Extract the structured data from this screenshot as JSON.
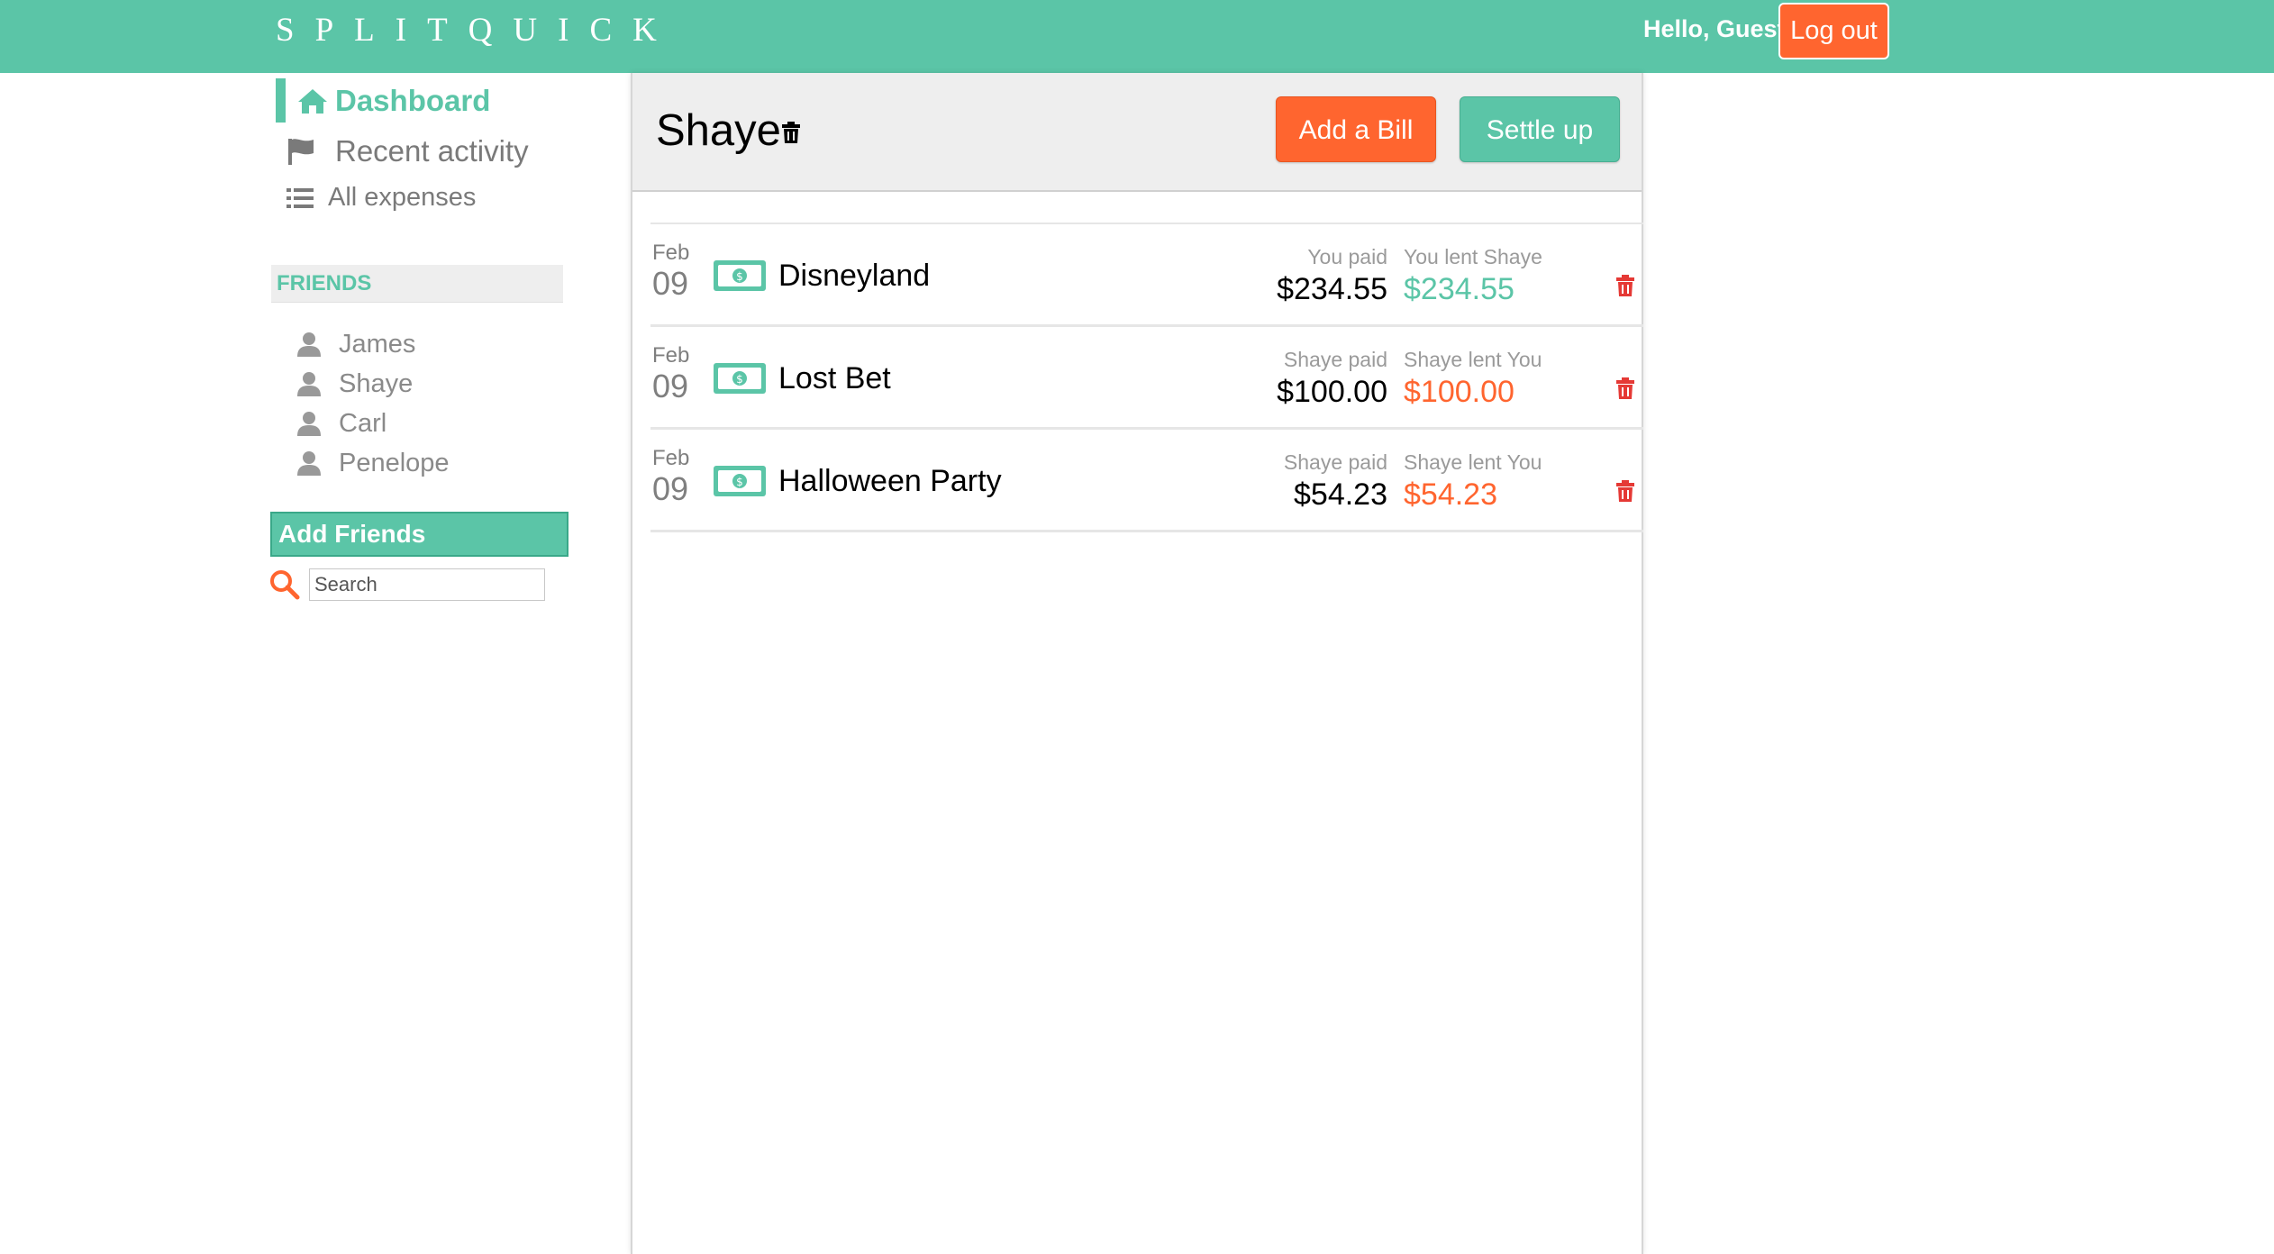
{
  "header": {
    "brand": "SPLITQUICK",
    "greeting": "Hello, Guest",
    "logout_label": "Log out",
    "bg_color": "#5bc5a7"
  },
  "sidebar": {
    "nav": [
      {
        "label": "Dashboard",
        "icon": "home-icon",
        "active": true
      },
      {
        "label": "Recent activity",
        "icon": "flag-icon"
      },
      {
        "label": "All expenses",
        "icon": "list-icon"
      }
    ],
    "friends_heading": "FRIENDS",
    "friends": [
      "James",
      "Shaye",
      "Carl",
      "Penelope"
    ],
    "add_friends_label": "Add Friends",
    "search": {
      "placeholder": "Search",
      "value": ""
    }
  },
  "main": {
    "title": "Shaye",
    "add_bill_label": "Add a Bill",
    "settle_up_label": "Settle up",
    "expenses": [
      {
        "month": "Feb",
        "day": "09",
        "title": "Disneyland",
        "paid_label": "You paid",
        "paid_amount": "$234.55",
        "lent_label": "You lent Shaye",
        "lent_amount": "$234.55",
        "lent_color": "green"
      },
      {
        "month": "Feb",
        "day": "09",
        "title": "Lost Bet",
        "paid_label": "Shaye paid",
        "paid_amount": "$100.00",
        "lent_label": "Shaye lent You",
        "lent_amount": "$100.00",
        "lent_color": "orange"
      },
      {
        "month": "Feb",
        "day": "09",
        "title": "Halloween Party",
        "paid_label": "Shaye paid",
        "paid_amount": "$54.23",
        "lent_label": "Shaye lent You",
        "lent_amount": "$54.23",
        "lent_color": "orange"
      }
    ]
  },
  "colors": {
    "accent_green": "#5bc5a7",
    "accent_orange": "#ff652f",
    "delete_red": "#e53935"
  }
}
